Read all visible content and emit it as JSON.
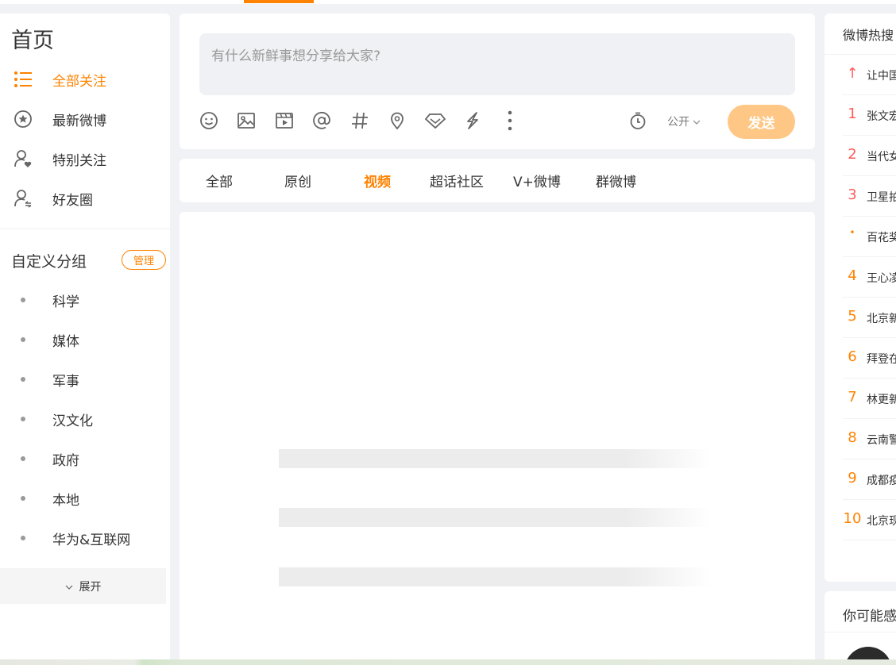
{
  "left_nav": {
    "title": "首页",
    "items": [
      {
        "label": "全部关注",
        "icon": "list-icon",
        "active": true
      },
      {
        "label": "最新微博",
        "icon": "star-circle-icon",
        "active": false
      },
      {
        "label": "特别关注",
        "icon": "user-heart-icon",
        "active": false
      },
      {
        "label": "好友圈",
        "icon": "user-friends-icon",
        "active": false
      }
    ],
    "group_title": "自定义分组",
    "manage_label": "管理",
    "groups": [
      "科学",
      "媒体",
      "军事",
      "汉文化",
      "政府",
      "本地",
      "华为&互联网"
    ],
    "expand_label": "展开"
  },
  "composer": {
    "placeholder": "有什么新鲜事想分享给大家?",
    "tools": [
      "emoji-icon",
      "image-icon",
      "video-icon",
      "mention-icon",
      "topic-icon",
      "location-icon",
      "diamond-icon",
      "lightning-icon",
      "more-icon"
    ],
    "visibility": "公开",
    "send_label": "发送"
  },
  "tabs": [
    {
      "label": "全部",
      "active": false
    },
    {
      "label": "原创",
      "active": false
    },
    {
      "label": "视频",
      "active": true
    },
    {
      "label": "超话社区",
      "active": false
    },
    {
      "label": "V+微博",
      "active": false
    },
    {
      "label": "群微博",
      "active": false
    }
  ],
  "hot_search": {
    "title": "微博热搜",
    "items": [
      {
        "rank": "↑",
        "text": "让中国"
      },
      {
        "rank": "1",
        "text": "张文宏"
      },
      {
        "rank": "2",
        "text": "当代女"
      },
      {
        "rank": "3",
        "text": "卫星拍"
      },
      {
        "rank": "•",
        "text": "百花奖"
      },
      {
        "rank": "4",
        "text": "王心凌"
      },
      {
        "rank": "5",
        "text": "北京新"
      },
      {
        "rank": "6",
        "text": "拜登在"
      },
      {
        "rank": "7",
        "text": "林更新"
      },
      {
        "rank": "8",
        "text": "云南警"
      },
      {
        "rank": "9",
        "text": "成都疫"
      },
      {
        "rank": "10",
        "text": "北京现"
      }
    ]
  },
  "recommend": {
    "title": "你可能感兴趣"
  },
  "colors": {
    "accent": "#ff8200",
    "hot_top3": "#ff5c5c",
    "send_disabled": "#ffc785"
  }
}
